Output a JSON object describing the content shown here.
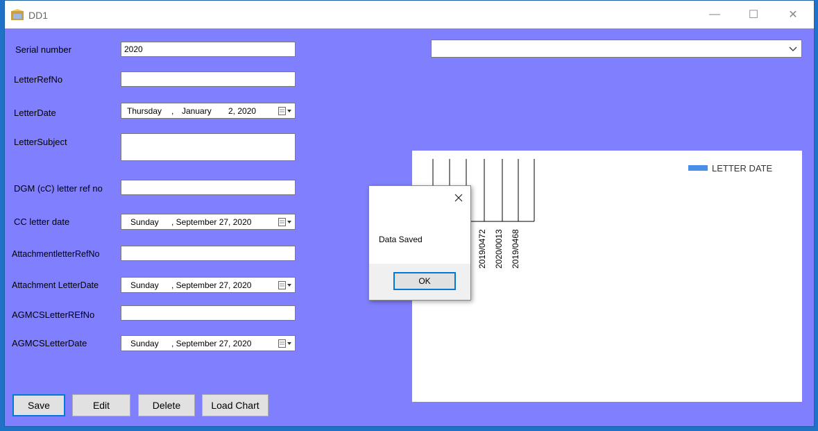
{
  "window": {
    "title": "DD1"
  },
  "titlebar": {
    "minimize": "—",
    "maximize": "☐",
    "close": "✕"
  },
  "form": {
    "serial_label": "Serial number",
    "serial_value": "2020",
    "letter_ref_label": "LetterRefNo",
    "letter_ref_value": "",
    "letter_date_label": "LetterDate",
    "letter_date_day": "Thursday",
    "letter_date_sep": ",",
    "letter_date_month": "January",
    "letter_date_daynum": "2, 2020",
    "letter_subject_label": "LetterSubject",
    "letter_subject_value": "",
    "dgm_label": "DGM (cC) letter ref no",
    "dgm_value": "",
    "cc_date_label": "CC letter date",
    "cc_date_day": "Sunday",
    "cc_date_rest": ", September 27, 2020",
    "att_ref_label": "AttachmentletterRefNo",
    "att_ref_value": "",
    "att_date_label": "Attachment LetterDate",
    "att_date_day": "Sunday",
    "att_date_rest": ", September 27, 2020",
    "agmcs_ref_label": "AGMCSLetterREfNo",
    "agmcs_ref_value": "",
    "agmcs_date_label": "AGMCSLetterDate",
    "agmcs_date_day": "Sunday",
    "agmcs_date_rest": ", September 27, 2020"
  },
  "buttons": {
    "save": "Save",
    "edit": "Edit",
    "delete": "Delete",
    "load_chart": "Load Chart"
  },
  "combo": {
    "value": ""
  },
  "chart_data": {
    "type": "bar",
    "categories": [
      "2019/0472",
      "2020/0013",
      "2019/0468"
    ],
    "series": [
      {
        "name": "LETTER DATE",
        "values": []
      }
    ],
    "legend_position": "top-right",
    "colors": {
      "series": "#4a8fe7",
      "axis": "#000000"
    }
  },
  "dialog": {
    "message": "Data Saved",
    "ok_label": "OK"
  },
  "colors": {
    "form_background": "#8080ff",
    "accent": "#0078d7"
  }
}
